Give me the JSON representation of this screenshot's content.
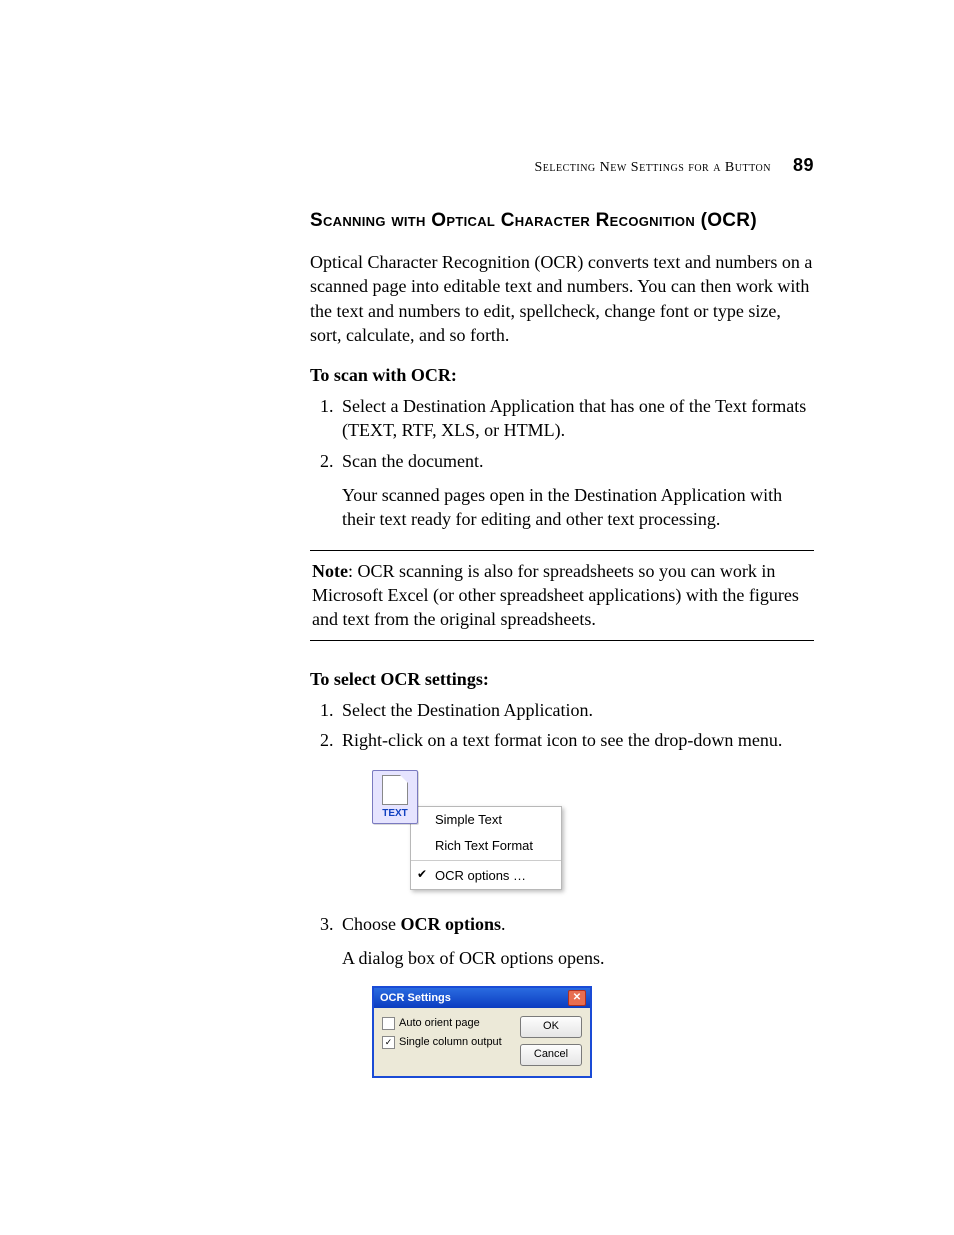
{
  "header": {
    "running": "Selecting New Settings for a Button",
    "page_number": "89"
  },
  "section_title": "Scanning with Optical Character Recognition (OCR)",
  "intro": "Optical Character Recognition (OCR) converts text and numbers on a scanned page into editable text and numbers. You can then work with the text and numbers to edit, spellcheck, change font or type size, sort, calculate, and so forth.",
  "scan_label": "To scan with OCR:",
  "scan_steps": {
    "s1": "Select a Destination Application that has one of the Text formats (TEXT, RTF, XLS, or HTML).",
    "s2": "Scan the document.",
    "s2_follow": "Your scanned pages open in the Destination Application with their text ready for editing and other text processing."
  },
  "note": {
    "label": "Note",
    "body": ":  OCR scanning is also for spreadsheets so you can work in Microsoft Excel (or other spreadsheet applications) with the figures and text from the original spreadsheets."
  },
  "select_label": "To select OCR settings:",
  "select_steps": {
    "s1": "Select the Destination Application.",
    "s2": "Right-click on a text format icon to see the drop-down menu.",
    "s3_pre": "Choose ",
    "s3_bold": "OCR options",
    "s3_post": ".",
    "s3_follow": "A dialog box of OCR options opens."
  },
  "menu": {
    "tile_caption": "TEXT",
    "items": {
      "simple": "Simple Text",
      "rtf": "Rich Text Format",
      "ocr": "OCR options …"
    }
  },
  "dialog": {
    "title": "OCR Settings",
    "close_glyph": "✕",
    "opts": {
      "auto": "Auto orient page",
      "single": "Single column output",
      "single_check": "✓"
    },
    "buttons": {
      "ok": "OK",
      "cancel": "Cancel"
    }
  }
}
